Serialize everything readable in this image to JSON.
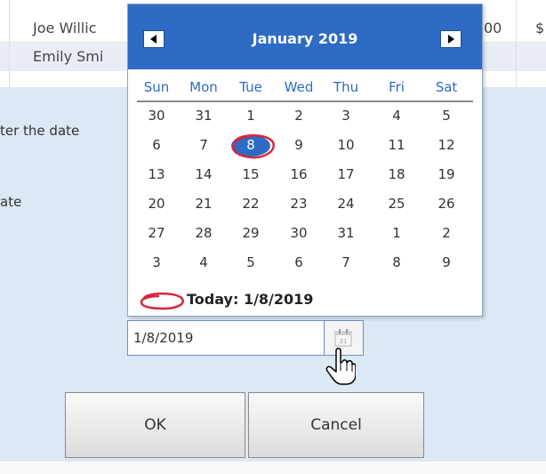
{
  "background_table": {
    "rows": [
      {
        "name": "Joe Willic",
        "partial": "00",
        "partial2": "$"
      },
      {
        "name": "Emily Smi"
      }
    ]
  },
  "dialog": {
    "label1": "ter the date",
    "label2": "ate",
    "date_value": "1/8/2019",
    "ok_label": "OK",
    "cancel_label": "Cancel"
  },
  "calendar": {
    "prev_icon": "triangle-left-icon",
    "next_icon": "triangle-right-icon",
    "month_title": "January 2019",
    "days_of_week": [
      "Sun",
      "Mon",
      "Tue",
      "Wed",
      "Thu",
      "Fri",
      "Sat"
    ],
    "weeks": [
      [
        "30",
        "31",
        "1",
        "2",
        "3",
        "4",
        "5"
      ],
      [
        "6",
        "7",
        "8",
        "9",
        "10",
        "11",
        "12"
      ],
      [
        "13",
        "14",
        "15",
        "16",
        "17",
        "18",
        "19"
      ],
      [
        "20",
        "21",
        "22",
        "23",
        "24",
        "25",
        "26"
      ],
      [
        "27",
        "28",
        "29",
        "30",
        "31",
        "1",
        "2"
      ],
      [
        "3",
        "4",
        "5",
        "6",
        "7",
        "8",
        "9"
      ]
    ],
    "selected_day": "8",
    "today_label": "Today: 1/8/2019"
  },
  "colors": {
    "header_blue": "#2d6bc4",
    "annotation_red": "#d7263d",
    "dialog_bg": "#dce8f3"
  }
}
